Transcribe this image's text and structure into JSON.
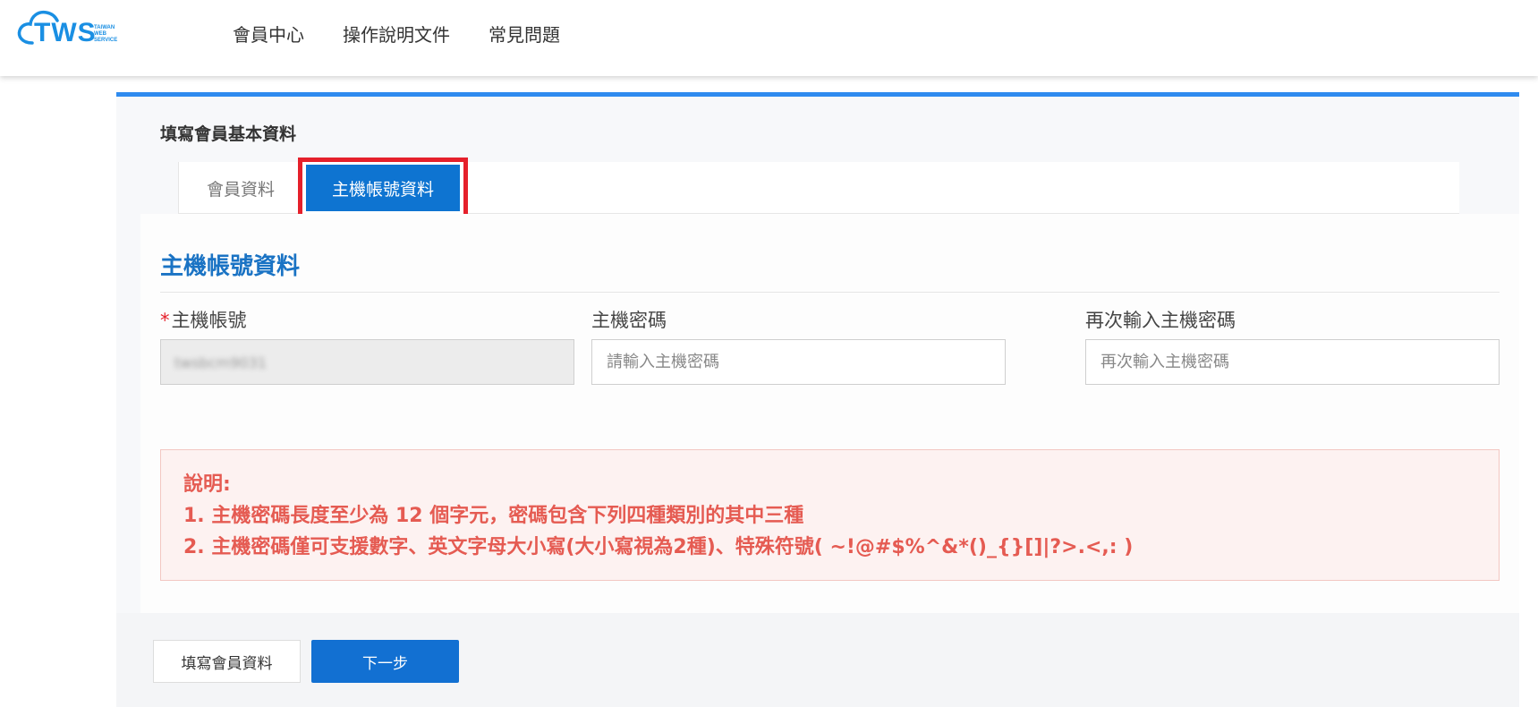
{
  "logo": {
    "main": "TWS",
    "sub": [
      "TAIWAN",
      "WEB",
      "SERVICE"
    ]
  },
  "nav": {
    "items": [
      "會員中心",
      "操作說明文件",
      "常見問題"
    ]
  },
  "form": {
    "title": "填寫會員基本資料",
    "tabs": [
      {
        "label": "會員資料",
        "active": false
      },
      {
        "label": "主機帳號資料",
        "active": true
      }
    ],
    "section_title": "主機帳號資料",
    "fields": {
      "account": {
        "label": "主機帳號",
        "required_mark": "*",
        "value": "twsbcm9031"
      },
      "password": {
        "label": "主機密碼",
        "placeholder": "請輸入主機密碼"
      },
      "password_confirm": {
        "label": "再次輸入主機密碼",
        "placeholder": "再次輸入主機密碼"
      }
    },
    "notice": {
      "title": "說明:",
      "lines": [
        "1. 主機密碼長度至少為 12 個字元，密碼包含下列四種類別的其中三種",
        "2. 主機密碼僅可支援數字、英文字母大小寫(大小寫視為2種)、特殊符號( ~!@#$%^&*()_{}[]|?>.<,: )"
      ]
    },
    "buttons": {
      "back": "填寫會員資料",
      "next": "下一步"
    }
  },
  "colors": {
    "accent": "#0e74d1",
    "highlight_outline": "#e5202b",
    "notice_text": "#e55b52"
  }
}
